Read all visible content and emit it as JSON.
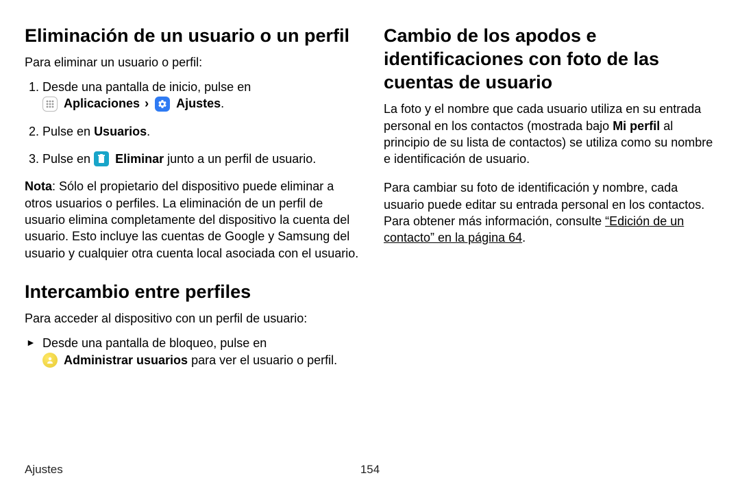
{
  "left": {
    "h_delete": "Eliminación de un usuario o un perfil",
    "intro_delete": "Para eliminar un usuario o perfil:",
    "step1_a": "Desde una pantalla de inicio, pulse en ",
    "apps_label": "Aplicaciones",
    "settings_label": "Ajustes",
    "step2_a": "Pulse en ",
    "step2_b": "Usuarios",
    "step2_c": ".",
    "step3_a": "Pulse en ",
    "step3_b": "Eliminar",
    "step3_c": " junto a un perfil de usuario.",
    "note_label": "Nota",
    "note_body": ": Sólo el propietario del dispositivo puede eliminar a otros usuarios o perfiles. La eliminación de un perfil de usuario elimina completamente del dispositivo la cuenta del usuario. Esto incluye las cuentas de Google y Samsung del usuario y cualquier otra cuenta local asociada con el usuario.",
    "h_switch": "Intercambio entre perfiles",
    "intro_switch": "Para acceder al dispositivo con un perfil de usuario:",
    "switch_a": "Desde una pantalla de bloqueo, pulse en ",
    "switch_b": "Administrar usuarios",
    "switch_c": " para ver el usuario o perfil."
  },
  "right": {
    "h_change": "Cambio de los apodos e identificaciones con foto de las cuentas de usuario",
    "p1_a": "La foto y el nombre que cada usuario utiliza en su entrada personal en los contactos (mostrada bajo ",
    "p1_b": "Mi perfil",
    "p1_c": " al principio de su lista de contactos) se utiliza como su nombre e identificación de usuario.",
    "p2_a": "Para cambiar su foto de identificación y nombre, cada usuario puede editar su entrada personal en los contactos. Para obtener más información, consulte ",
    "p2_link": "“Edición de un contacto” en la página 64",
    "p2_b": "."
  },
  "footer": {
    "section": "Ajustes",
    "page": "154"
  }
}
